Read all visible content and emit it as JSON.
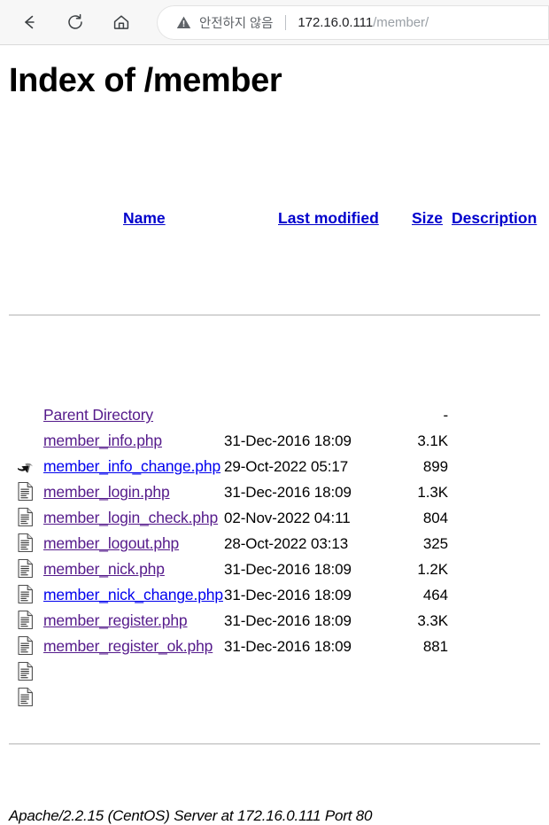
{
  "browser": {
    "back_label": "Back",
    "reload_label": "Reload",
    "home_label": "Home",
    "security_label": "안전하지 않음",
    "url_host": "172.16.0.111",
    "url_path": "/member/",
    "warning_icon": "warning-triangle-icon",
    "colors": {
      "toolbar_bg": "#f7f7f7",
      "omnibox_bg": "#ffffff",
      "security_text": "#5f6368",
      "url_host": "#202124",
      "url_path": "#9aa0a6"
    }
  },
  "page": {
    "title": "Index of /member",
    "columns": {
      "name": "Name",
      "last_modified": "Last modified",
      "size": "Size",
      "description": "Description"
    },
    "colors": {
      "link": "#0000cc",
      "visited_link": "#551a8b",
      "unvisited_link": "#0000ee",
      "rule": "#b3b3b3",
      "text": "#000000"
    },
    "rows": [
      {
        "icon": "parent-directory-icon",
        "name": "Parent Directory",
        "date": "",
        "size": "-",
        "description": "",
        "link_state": "visited"
      },
      {
        "icon": "text-file-icon",
        "name": "member_info.php",
        "date": "31-Dec-2016 18:09",
        "size": "3.1K",
        "description": "",
        "link_state": "visited"
      },
      {
        "icon": "text-file-icon",
        "name": "member_info_change.php",
        "date": "29-Oct-2022 05:17",
        "size": "899",
        "description": "",
        "link_state": "unvisited"
      },
      {
        "icon": "text-file-icon",
        "name": "member_login.php",
        "date": "31-Dec-2016 18:09",
        "size": "1.3K",
        "description": "",
        "link_state": "visited"
      },
      {
        "icon": "text-file-icon",
        "name": "member_login_check.php",
        "date": "02-Nov-2022 04:11",
        "size": "804",
        "description": "",
        "link_state": "visited"
      },
      {
        "icon": "text-file-icon",
        "name": "member_logout.php",
        "date": "28-Oct-2022 03:13",
        "size": "325",
        "description": "",
        "link_state": "visited"
      },
      {
        "icon": "text-file-icon",
        "name": "member_nick.php",
        "date": "31-Dec-2016 18:09",
        "size": "1.2K",
        "description": "",
        "link_state": "visited"
      },
      {
        "icon": "text-file-icon",
        "name": "member_nick_change.php",
        "date": "31-Dec-2016 18:09",
        "size": "464",
        "description": "",
        "link_state": "unvisited"
      },
      {
        "icon": "text-file-icon",
        "name": "member_register.php",
        "date": "31-Dec-2016 18:09",
        "size": "3.3K",
        "description": "",
        "link_state": "visited"
      },
      {
        "icon": "text-file-icon",
        "name": "member_register_ok.php",
        "date": "31-Dec-2016 18:09",
        "size": "881",
        "description": "",
        "link_state": "visited"
      }
    ],
    "footer": "Apache/2.2.15 (CentOS) Server at 172.16.0.111 Port 80"
  }
}
